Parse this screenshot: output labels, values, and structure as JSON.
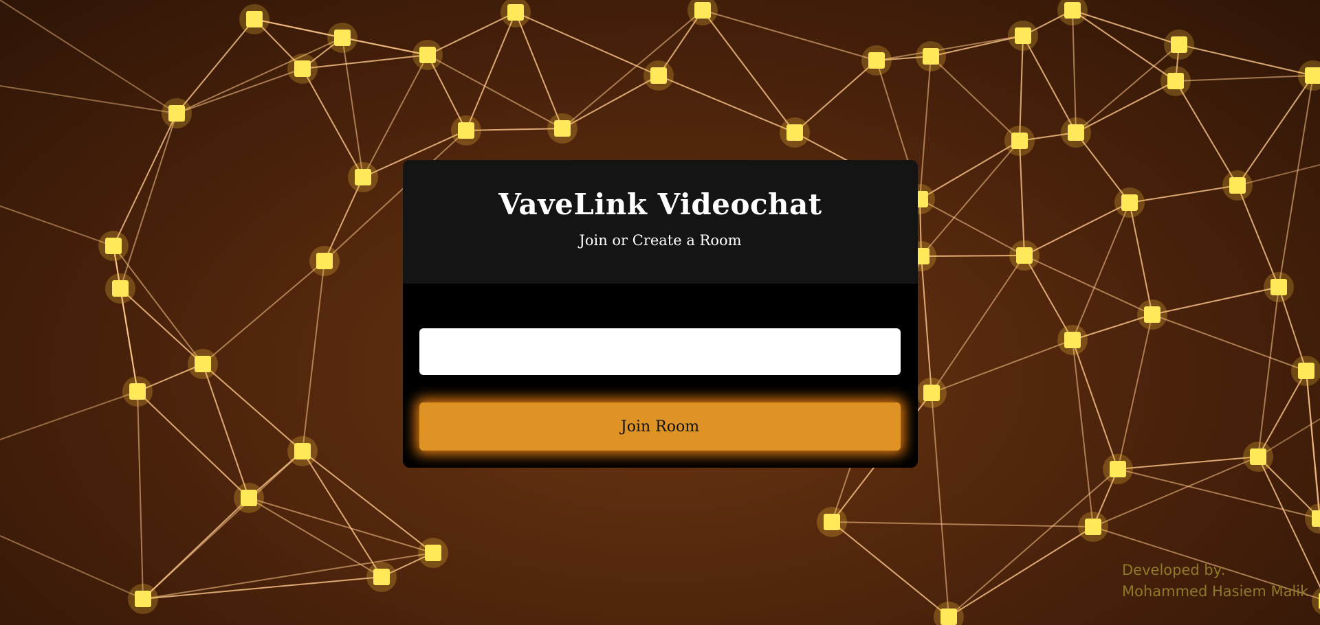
{
  "app": {
    "title": "VaveLink Videochat",
    "subtitle": "Join or Create a Room"
  },
  "form": {
    "room_input_value": "",
    "room_input_placeholder": "",
    "join_button_label": "Join Room"
  },
  "footer": {
    "credit_line1": "Developed by:",
    "credit_line2": "Mohammed Hasiem Malik"
  },
  "colors": {
    "accent": "#e09325",
    "card_header": "#141414",
    "card_body": "#000000",
    "credit_text": "#8f7a2a"
  }
}
